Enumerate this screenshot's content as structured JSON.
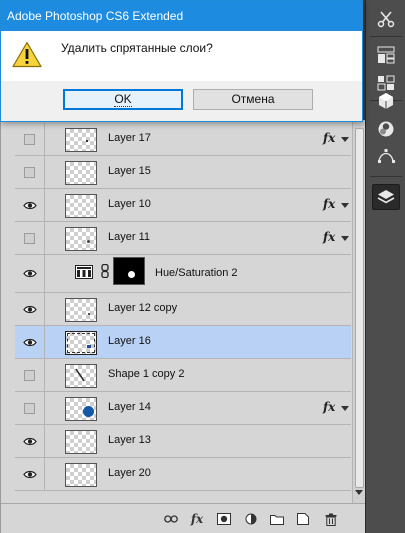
{
  "dialog": {
    "title": "Adobe Photoshop CS6 Extended",
    "message": "Удалить спрятанные слои?",
    "ok_label": "OK",
    "cancel_label": "Отмена"
  },
  "layers": [
    {
      "name": "Layer 17",
      "visible": false,
      "fx": true,
      "thumb": "tiny-mark"
    },
    {
      "name": "Layer 15",
      "visible": false,
      "fx": false,
      "thumb": "empty"
    },
    {
      "name": "Layer 10",
      "visible": true,
      "fx": true,
      "thumb": "empty"
    },
    {
      "name": "Layer 11",
      "visible": false,
      "fx": true,
      "thumb": "tiny-mark"
    },
    {
      "name": "Hue/Saturation 2",
      "visible": true,
      "fx": false,
      "thumb": "adjustment"
    },
    {
      "name": "Layer 12 copy",
      "visible": true,
      "fx": false,
      "thumb": "tiny-mark"
    },
    {
      "name": "Layer 16",
      "visible": true,
      "fx": false,
      "thumb": "tiny-mark",
      "selected": true
    },
    {
      "name": "Shape 1 copy 2",
      "visible": false,
      "fx": false,
      "thumb": "diagonal"
    },
    {
      "name": "Layer 14",
      "visible": false,
      "fx": true,
      "thumb": "blue-dot"
    },
    {
      "name": "Layer 13",
      "visible": true,
      "fx": false,
      "thumb": "empty"
    },
    {
      "name": "Layer 20",
      "visible": true,
      "fx": false,
      "thumb": "empty"
    }
  ],
  "footer": {
    "fx_label": "fx"
  },
  "colors": {
    "titlebar": "#1d8be0",
    "selected_row": "#b9d1f5",
    "panel_bg": "#d6d6d6"
  }
}
